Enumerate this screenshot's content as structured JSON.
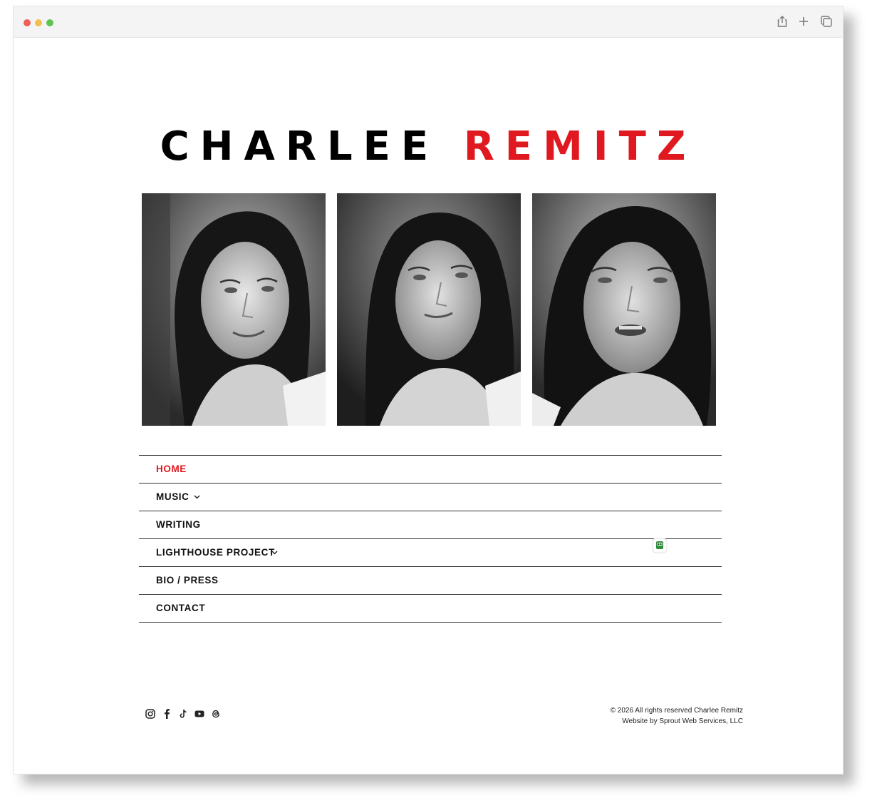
{
  "site": {
    "title_first": "CHARLEE",
    "title_last": "REMITZ",
    "accent_color": "#e0181f"
  },
  "photos": [
    {
      "alt": "Charlee Remitz portrait 1"
    },
    {
      "alt": "Charlee Remitz portrait 2"
    },
    {
      "alt": "Charlee Remitz portrait 3"
    }
  ],
  "nav": {
    "items": [
      {
        "label": "HOME",
        "active": true,
        "has_dropdown": false
      },
      {
        "label": "MUSIC",
        "active": false,
        "has_dropdown": true
      },
      {
        "label": "WRITING",
        "active": false,
        "has_dropdown": false
      },
      {
        "label": "LIGHTHOUSE PROJECT",
        "active": false,
        "has_dropdown": true
      },
      {
        "label": "BIO / PRESS",
        "active": false,
        "has_dropdown": false
      },
      {
        "label": "CONTACT",
        "active": false,
        "has_dropdown": false
      }
    ]
  },
  "social": [
    "instagram-icon",
    "facebook-icon",
    "tiktok-icon",
    "youtube-icon",
    "threads-icon"
  ],
  "footer": {
    "copyright": "© 2026 All rights reserved Charlee Remitz",
    "credit": "Website by Sprout Web Services, LLC"
  },
  "browser": {
    "toolbar_icons": [
      "share-icon",
      "new-tab-icon",
      "tabs-overview-icon"
    ]
  }
}
